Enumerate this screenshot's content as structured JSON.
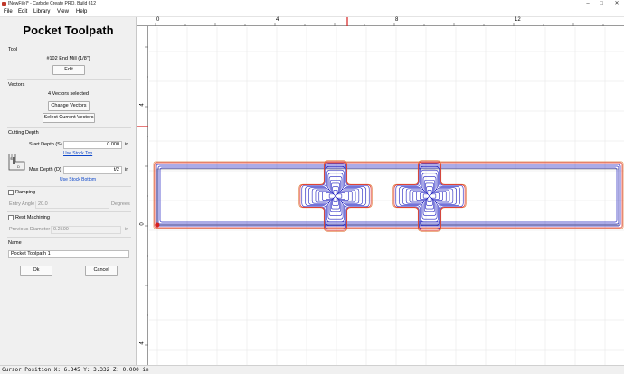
{
  "window": {
    "title": "[NewFile]* - Carbide Create PRO, Build 612"
  },
  "menu": [
    "File",
    "Edit",
    "Library",
    "View",
    "Help"
  ],
  "panel": {
    "title": "Pocket Toolpath",
    "tool": {
      "heading": "Tool",
      "name": "#102 End Mill (1/8\")",
      "edit_label": "Edit"
    },
    "vectors": {
      "heading": "Vectors",
      "selected": "4 Vectors selected",
      "change_label": "Change Vectors",
      "select_label": "Select Current Vectors"
    },
    "cutting": {
      "heading": "Cutting Depth",
      "start_label": "Start Depth (S)",
      "start_value": "0.000",
      "start_unit": "in",
      "use_stock_top": "Use Stock Top",
      "max_label": "Max Depth (D)",
      "max_value": "t/2",
      "max_unit": "in",
      "use_stock_bottom": "Use Stock Bottom"
    },
    "ramping": {
      "label": "Ramping",
      "angle_label": "Entry Angle",
      "angle_value": "20.0",
      "angle_unit": "Degrees"
    },
    "rest": {
      "label": "Rest Machining",
      "diam_label": "Previous Diameter",
      "diam_value": "0.2500",
      "diam_unit": "in"
    },
    "name": {
      "heading": "Name",
      "value": "Pocket Toolpath 1"
    },
    "ok_label": "Ok",
    "cancel_label": "Cancel"
  },
  "ruler": {
    "top_labels": [
      "0",
      "4",
      "8",
      "12"
    ],
    "left_labels": [
      "4",
      "0",
      "4"
    ]
  },
  "status": "Cursor Position X: 6.345 Y: 3.332 Z: 0.000 in",
  "colors": {
    "toolpath_blue": "#2020c0",
    "outline_red": "#e03030",
    "outline_orange": "#e08040",
    "grid": "#e6e6e6",
    "cursor_marker": "#d62020"
  }
}
